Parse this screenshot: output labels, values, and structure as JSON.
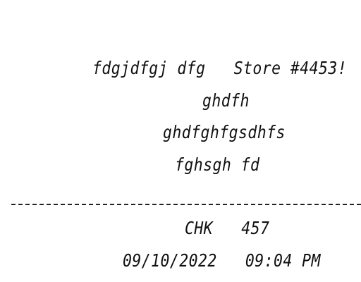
{
  "receipt": {
    "store_line": "fdgjdfgj dfg   Store #4453!",
    "address_line_1": "ghdfh",
    "address_line_2": "ghdfghfgsdhfs",
    "address_line_3": "fghsgh fd",
    "check_line": "CHK   457",
    "datetime_line": "09/10/2022   09:04 PM"
  }
}
